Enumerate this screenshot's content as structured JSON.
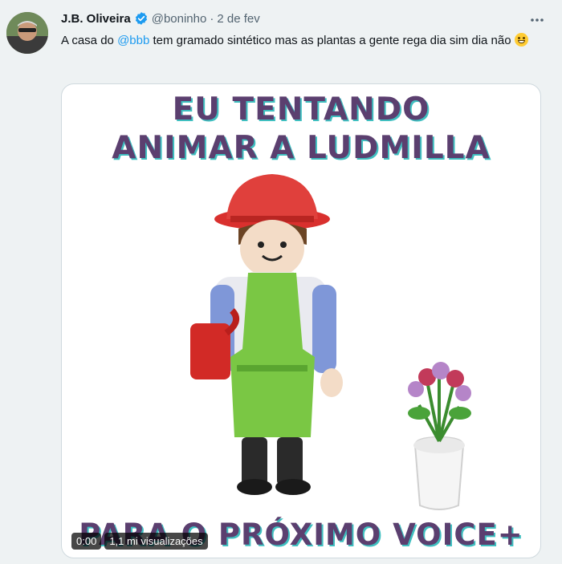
{
  "tweet": {
    "author_name": "J.B. Oliveira",
    "handle": "@boninho",
    "separator": "·",
    "date": "2 de fev",
    "text_before": "A casa do ",
    "mention": "@bbb",
    "text_after": " tem gramado sintético mas as plantas a gente rega dia sim dia não ",
    "emoji": "grinning-face-emoji",
    "more_icon": "more-horizontal-icon",
    "verified_icon": "verified-badge-icon"
  },
  "media": {
    "caption_top_line1": "EU TENTANDO",
    "caption_top_line2": "ANIMAR A LUDMILLA",
    "caption_bottom": "PARA O PRÓXIMO VOICE+",
    "time": "0:00",
    "views": "1,1 mi visualizações"
  },
  "colors": {
    "link": "#1d9bf0",
    "verified": "#1d9bf0",
    "caption": "#5b3f6f",
    "caption_shadow": "#3fbfc0"
  }
}
